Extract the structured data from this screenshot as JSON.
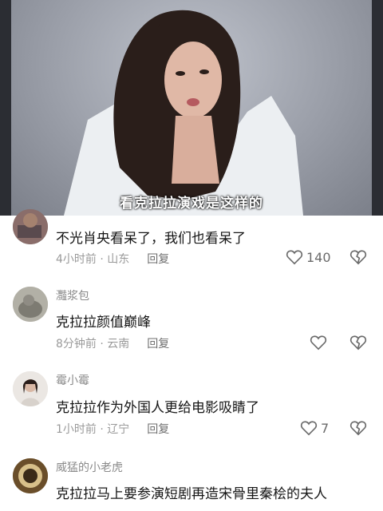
{
  "video": {
    "subtitle": "看克拉拉演戏是这样的"
  },
  "comments": [
    {
      "username": "",
      "text": "不光肖央看呆了，我们也看呆了",
      "time": "4小时前 · 山东",
      "reply": "回复",
      "likes": "140"
    },
    {
      "username": "灩浆包",
      "text": "克拉拉颜值巅峰",
      "time": "8分钟前 · 云南",
      "reply": "回复",
      "likes": ""
    },
    {
      "username": "霉小霉",
      "text": "克拉拉作为外国人更给电影吸睛了",
      "time": "1小时前 · 辽宁",
      "reply": "回复",
      "likes": "7"
    },
    {
      "username": "威猛的小老虎",
      "text": "克拉拉马上要参演短剧再造宋骨里秦桧的夫人",
      "time": "",
      "reply": "",
      "likes": ""
    }
  ],
  "colors": {
    "text": "#161616",
    "meta": "#9a9a9a",
    "icon": "#6a6a6a"
  }
}
